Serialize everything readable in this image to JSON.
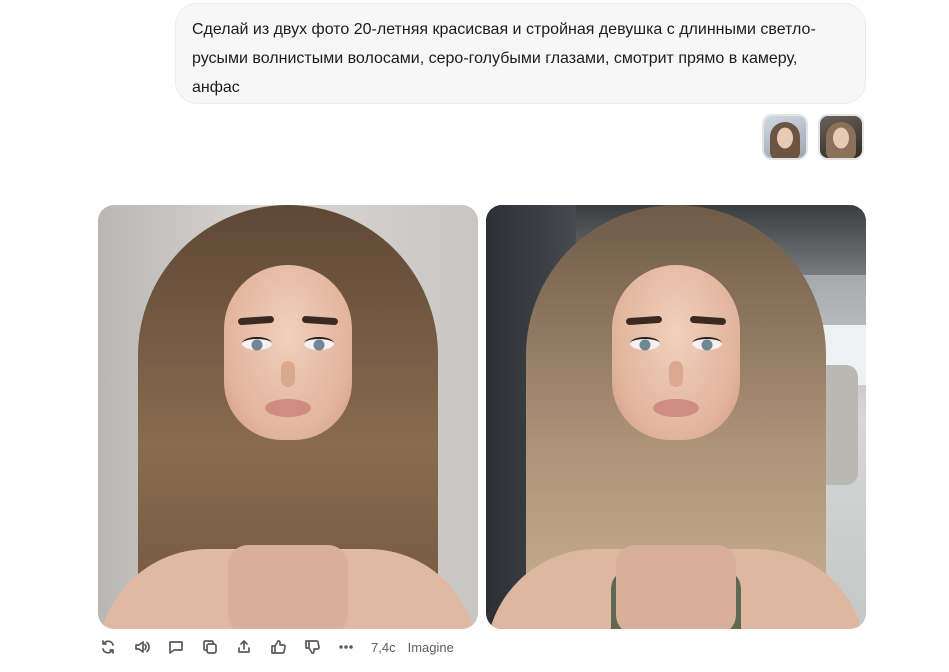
{
  "chat": {
    "user_message": "Сделай из двух фото 20-летняя красисвая и стройная девушка с длинными светло-русыми волнистыми волосами, серо-голубыми глазами, смотрит прямо в камеру, анфас",
    "attachments": [
      {
        "icon": "portrait-thumbnail-1"
      },
      {
        "icon": "portrait-thumbnail-2"
      }
    ]
  },
  "response": {
    "images": [
      {
        "icon": "generated-portrait-studio"
      },
      {
        "icon": "generated-portrait-car-selfie"
      }
    ],
    "actions": {
      "icons": [
        "regenerate-icon",
        "read-aloud-icon",
        "comment-icon",
        "copy-icon",
        "share-icon",
        "thumbs-up-icon",
        "thumbs-down-icon",
        "more-icon"
      ],
      "duration": "7,4с",
      "model": "Imagine"
    }
  }
}
